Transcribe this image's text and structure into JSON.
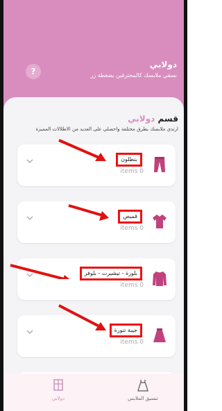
{
  "header": {
    "title": "دولابي",
    "subtitle": "نسقي ملابسك كالمحترفين بضغطة زر",
    "help_icon": "?"
  },
  "section": {
    "title_prefix": "قسم",
    "title_accent": "دولابي",
    "description": "ارتدي ملابسك بطرق مختلفة واحصلي على العديد من الاطلالات المميزة"
  },
  "categories": [
    {
      "label": "بنطلون",
      "count": "items 0",
      "icon": "pants-icon"
    },
    {
      "label": "قميص",
      "count": "items 0",
      "icon": "shirt-icon"
    },
    {
      "label": "بلوزة - تيشيرت - بلوفر",
      "count": "items 0",
      "icon": "sweater-icon"
    },
    {
      "label": "جيبة تنورة",
      "count": "items 0",
      "icon": "skirt-icon"
    }
  ],
  "bottom_nav": {
    "wardrobe_label": "دولابي",
    "outfit_label": "تنسيق الملابس"
  },
  "colors": {
    "brand_pink": "#d98dbe",
    "icon_pink": "#c0427c",
    "annotation_red": "#e11111"
  }
}
